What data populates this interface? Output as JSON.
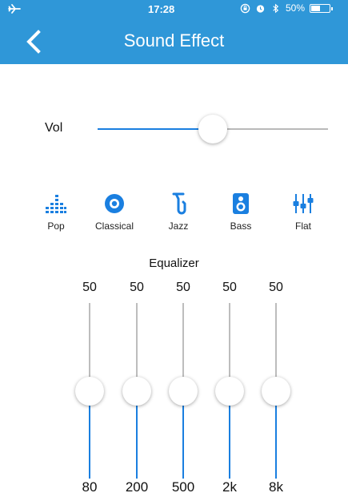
{
  "status_bar": {
    "time": "17:28",
    "battery_text": "50%",
    "battery_level": 0.5,
    "icons": [
      "airplane-mode-icon",
      "rotation-lock-icon",
      "alarm-icon",
      "bluetooth-icon",
      "battery-icon"
    ]
  },
  "header": {
    "title": "Sound Effect",
    "back_icon": "chevron-left-icon",
    "color": "#2f97d8"
  },
  "volume": {
    "label": "Vol",
    "level": 0.5,
    "accent": "#1a7fe0"
  },
  "presets": [
    {
      "label": "Pop",
      "icon": "equalizer-bars-icon"
    },
    {
      "label": "Classical",
      "icon": "vinyl-disc-icon"
    },
    {
      "label": "Jazz",
      "icon": "saxophone-icon"
    },
    {
      "label": "Bass",
      "icon": "speaker-icon"
    },
    {
      "label": "Flat",
      "icon": "mixer-sliders-icon"
    }
  ],
  "equalizer": {
    "title": "Equalizer",
    "bands": [
      {
        "freq": "80",
        "value": "50",
        "level": 0.5
      },
      {
        "freq": "200",
        "value": "50",
        "level": 0.5
      },
      {
        "freq": "500",
        "value": "50",
        "level": 0.5
      },
      {
        "freq": "2k",
        "value": "50",
        "level": 0.5
      },
      {
        "freq": "8k",
        "value": "50",
        "level": 0.5
      }
    ]
  }
}
